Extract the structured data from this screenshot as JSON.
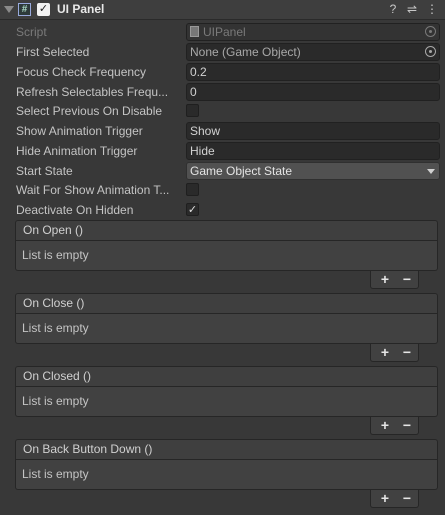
{
  "component": {
    "title": "UI Panel",
    "enabled_mark": "✓",
    "script_icon_glyph": "#"
  },
  "header_icons": {
    "help": "?",
    "presets": "⇌",
    "menu": "⋮"
  },
  "fields": {
    "script": {
      "label": "Script",
      "value": "UIPanel"
    },
    "first_selected": {
      "label": "First Selected",
      "value": "None (Game Object)"
    },
    "focus_check_frequency": {
      "label": "Focus Check Frequency",
      "value": "0.2"
    },
    "refresh_selectables_frequency": {
      "label": "Refresh Selectables Frequ...",
      "value": "0"
    },
    "select_previous_on_disable": {
      "label": "Select Previous On Disable",
      "checked": false
    },
    "show_animation_trigger": {
      "label": "Show Animation Trigger",
      "value": "Show"
    },
    "hide_animation_trigger": {
      "label": "Hide Animation Trigger",
      "value": "Hide"
    },
    "start_state": {
      "label": "Start State",
      "value": "Game Object State"
    },
    "wait_for_show_animation": {
      "label": "Wait For Show Animation T...",
      "checked": false
    },
    "deactivate_on_hidden": {
      "label": "Deactivate On Hidden",
      "checked": true,
      "mark": "✓"
    }
  },
  "events": [
    {
      "title": "On Open ()",
      "body": "List is empty"
    },
    {
      "title": "On Close ()",
      "body": "List is empty"
    },
    {
      "title": "On Closed ()",
      "body": "List is empty"
    },
    {
      "title": "On Back Button Down ()",
      "body": "List is empty"
    }
  ],
  "event_buttons": {
    "add": "+",
    "remove": "−"
  }
}
